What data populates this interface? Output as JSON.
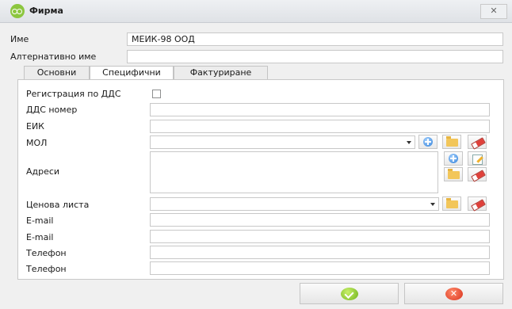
{
  "window": {
    "title": "Фирма",
    "close_glyph": "✕"
  },
  "fields": {
    "name_label": "Име",
    "name_value": "МЕИК-98 ООД",
    "alt_name_label": "Алтернативно име",
    "alt_name_value": ""
  },
  "tabs": [
    {
      "label": "Основни",
      "active": false
    },
    {
      "label": "Специфични",
      "active": true
    },
    {
      "label": "Фактуриране",
      "active": false
    }
  ],
  "specific": {
    "vat_registration_label": "Регистрация по ДДС",
    "vat_registered": false,
    "vat_number_label": "ДДС номер",
    "vat_number_value": "",
    "eik_label": "ЕИК",
    "eik_value": "",
    "mol_label": "МОЛ",
    "mol_value": "",
    "addresses_label": "Адреси",
    "price_list_label": "Ценова листа",
    "price_list_value": "",
    "email1_label": "E-mail",
    "email1_value": "",
    "email2_label": "E-mail",
    "email2_value": "",
    "phone1_label": "Телефон",
    "phone1_value": "",
    "phone2_label": "Телефон",
    "phone2_value": ""
  },
  "footer": {
    "ok_icon": "check-icon",
    "cancel_icon": "x-icon",
    "cancel_glyph": "✕"
  }
}
